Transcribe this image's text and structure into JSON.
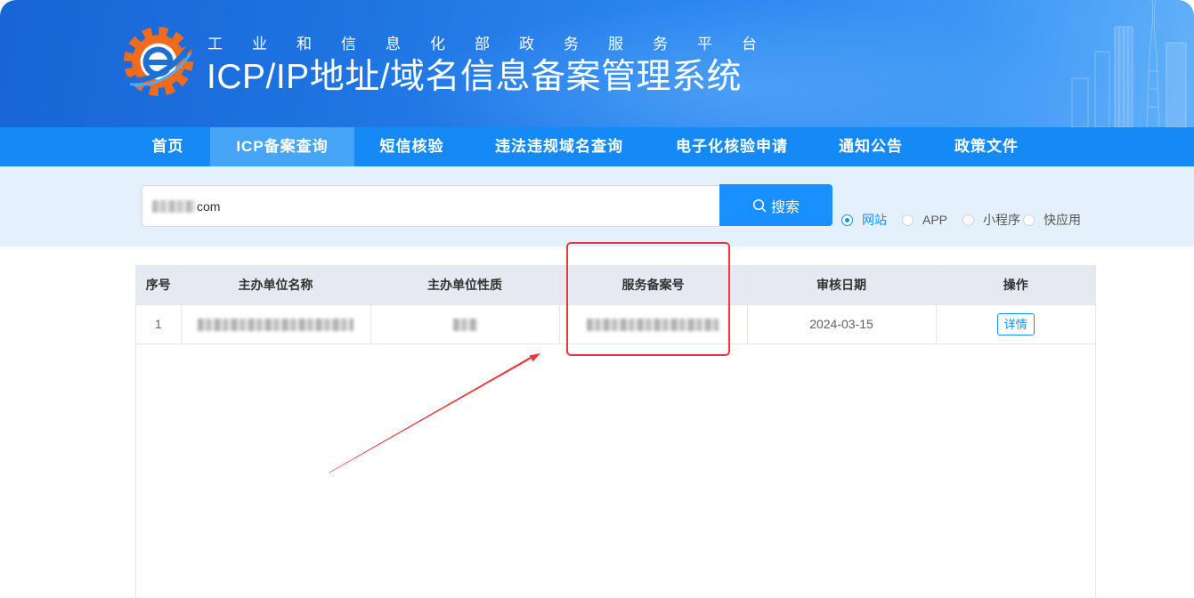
{
  "header": {
    "logo_icon": "gear-e-logo",
    "subtitle": "工业和信息化部政务服务平台",
    "title": "ICP/IP地址/域名信息备案管理系统"
  },
  "nav": {
    "items": [
      {
        "label": "首页",
        "active": false
      },
      {
        "label": "ICP备案查询",
        "active": true
      },
      {
        "label": "短信核验",
        "active": false
      },
      {
        "label": "违法违规域名查询",
        "active": false
      },
      {
        "label": "电子化核验申请",
        "active": false
      },
      {
        "label": "通知公告",
        "active": false
      },
      {
        "label": "政策文件",
        "active": false
      }
    ]
  },
  "search": {
    "query": "com",
    "button_label": "搜索",
    "button_icon": "search-icon",
    "types": [
      {
        "label": "网站",
        "selected": true
      },
      {
        "label": "APP",
        "selected": false
      },
      {
        "label": "小程序",
        "selected": false
      },
      {
        "label": "快应用",
        "selected": false
      }
    ]
  },
  "table": {
    "columns": [
      "序号",
      "主办单位名称",
      "主办单位性质",
      "服务备案号",
      "审核日期",
      "操作"
    ],
    "rows": [
      {
        "index": "1",
        "review_date": "2024-03-15",
        "action": "详情"
      }
    ]
  },
  "colors": {
    "header_start": "#1765d6",
    "header_end": "#63b1f9",
    "nav_bg": "#1589f5",
    "nav_active_bg": "#47a5f8",
    "search_band_bg": "#e4f0fc",
    "brand_blue": "#1890ff",
    "table_header_bg": "#e6e9ef",
    "annotation_red": "#e8383d",
    "logo_orange": "#f26b1d"
  }
}
